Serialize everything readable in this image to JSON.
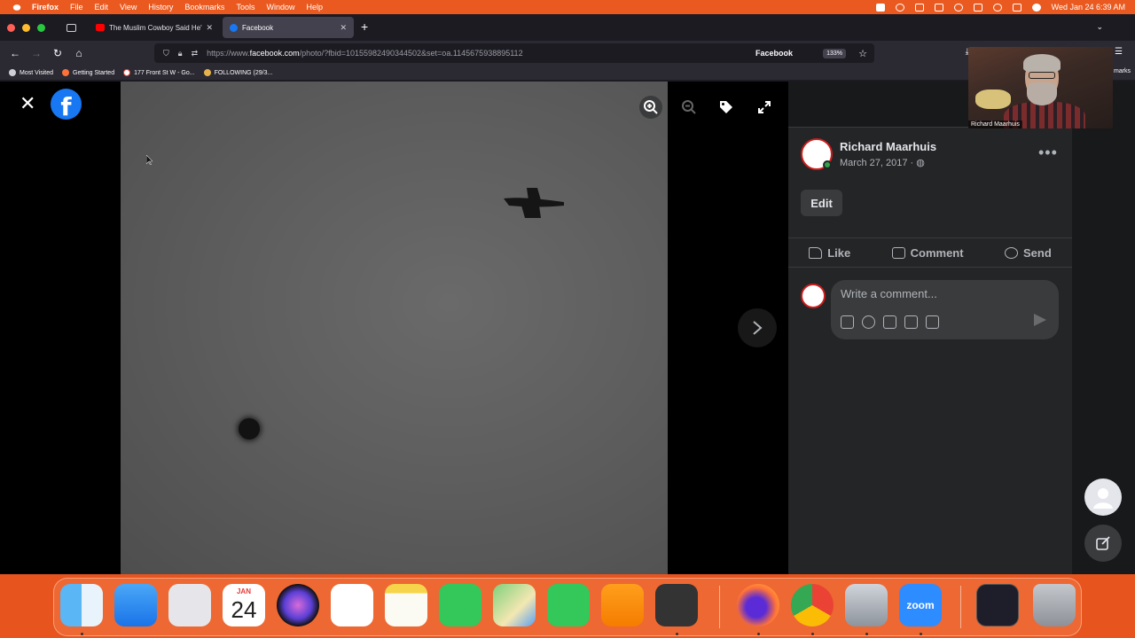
{
  "menubar": {
    "app_name": "Firefox",
    "items": [
      "File",
      "Edit",
      "View",
      "History",
      "Bookmarks",
      "Tools",
      "Window",
      "Help"
    ],
    "clock": "Wed Jan 24  6:39 AM"
  },
  "browser": {
    "tabs": [
      {
        "label": "The Muslim Cowboy Said He'll B",
        "favicon": "youtube-icon"
      },
      {
        "label": "Facebook",
        "favicon": "facebook-icon",
        "active": true
      }
    ],
    "url_prefix": "https://www.",
    "url_domain": "facebook.com",
    "url_path": "/photo/?fbid=10155982490344502&set=oa.1145675938895112",
    "site_label": "Facebook",
    "zoom_level": "133%",
    "bookmarks": [
      {
        "label": "Most Visited",
        "icon": "gear-icon"
      },
      {
        "label": "Getting Started",
        "icon": "firefox-icon"
      },
      {
        "label": "177 Front St W - Go...",
        "icon": "google-icon"
      },
      {
        "label": "FOLLOWING (29/3...",
        "icon": "leaf-icon"
      }
    ],
    "bookmarks_partial": "marks"
  },
  "post": {
    "author": "Richard Maarhuis",
    "date": "March 27, 2017 · ",
    "edit_label": "Edit",
    "actions": {
      "like": "Like",
      "comment": "Comment",
      "send": "Send"
    },
    "comment_placeholder": "Write a comment..."
  },
  "webcam": {
    "caption": "Richard Maarhuis"
  },
  "dock": {
    "calendar_month": "JAN",
    "calendar_day": "24",
    "zoom_label": "zoom"
  },
  "colors": {
    "facebook_blue": "#1877f2",
    "panel_bg": "#242526",
    "desktop_orange": "#e8541e"
  }
}
